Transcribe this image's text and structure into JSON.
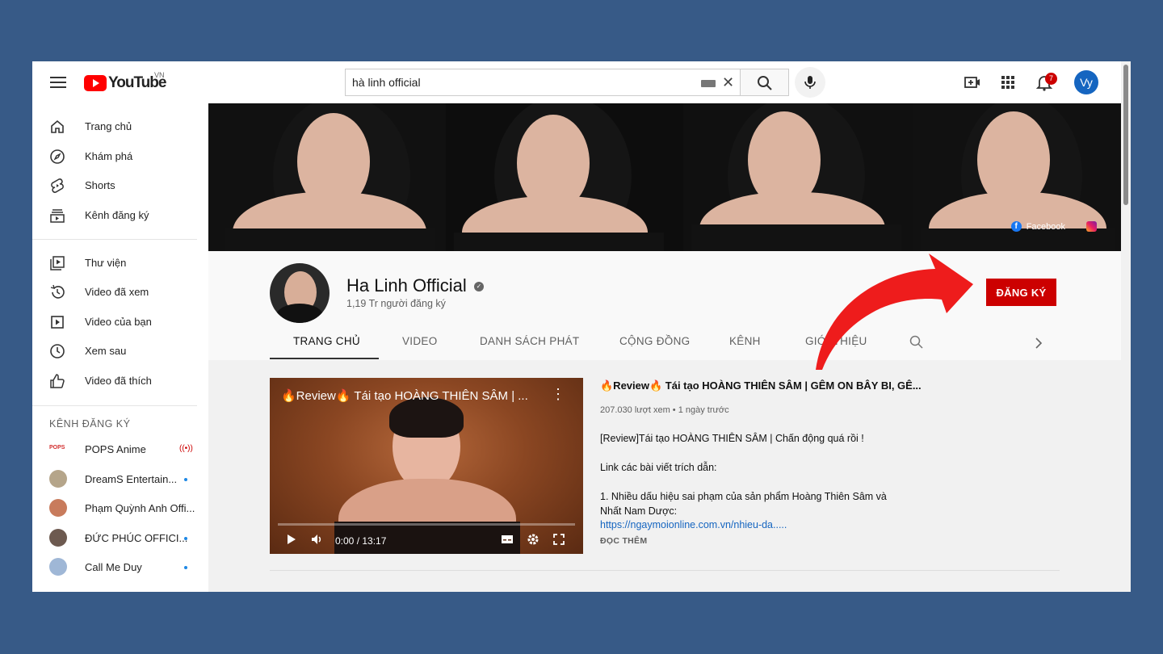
{
  "header": {
    "logo_text": "YouTube",
    "logo_region": "VN",
    "search_value": "hà linh official",
    "notification_count": "7",
    "avatar_initials": "Vy"
  },
  "sidebar": {
    "main": [
      {
        "label": "Trang chủ",
        "icon": "home-icon"
      },
      {
        "label": "Khám phá",
        "icon": "compass-icon"
      },
      {
        "label": "Shorts",
        "icon": "shorts-icon"
      },
      {
        "label": "Kênh đăng ký",
        "icon": "subscriptions-icon"
      }
    ],
    "library": [
      {
        "label": "Thư viện",
        "icon": "library-icon"
      },
      {
        "label": "Video đã xem",
        "icon": "history-icon"
      },
      {
        "label": "Video của bạn",
        "icon": "your-videos-icon"
      },
      {
        "label": "Xem sau",
        "icon": "clock-icon"
      },
      {
        "label": "Video đã thích",
        "icon": "thumbs-up-icon"
      }
    ],
    "subscriptions_heading": "KÊNH ĐĂNG KÝ",
    "subscriptions": [
      {
        "label": "POPS Anime",
        "status": "live"
      },
      {
        "label": "DreamS Entertain...",
        "status": "new"
      },
      {
        "label": "Phạm Quỳnh Anh Offi...",
        "status": ""
      },
      {
        "label": "ĐỨC PHÚC OFFICI...",
        "status": "new"
      },
      {
        "label": "Call Me Duy",
        "status": "new"
      }
    ]
  },
  "banner": {
    "facebook_label": "Facebook"
  },
  "channel": {
    "name": "Ha Linh Official",
    "subscribers": "1,19 Tr người đăng ký",
    "subscribe_label": "ĐĂNG KÝ",
    "tabs": [
      "TRANG CHỦ",
      "VIDEO",
      "DANH SÁCH PHÁT",
      "CỘNG ĐỒNG",
      "KÊNH",
      "GIỚI THIỆU"
    ]
  },
  "featured": {
    "player_title": "🔥Review🔥 Tái tạo HOÀNG THIÊN SÂM | ...",
    "time": "0:00 / 13:17",
    "title": "🔥Review🔥 Tái tạo HOÀNG THIÊN SÂM | GÊM ON BÂY BI, GÊ...",
    "meta": "207.030 lượt xem • 1 ngày trước",
    "desc_1": "[Review]Tái tạo HOÀNG THIÊN SÂM | Chấn động quá rồi !",
    "desc_2": "Link các bài viết trích dẫn:",
    "desc_3": "1. Nhiều dấu hiệu sai phạm của sản phẩm Hoàng Thiên Sâm và",
    "desc_4": "Nhất Nam Dược:",
    "link": "https://ngaymoionline.com.vn/nhieu-da.....",
    "read_more": "ĐỌC THÊM"
  },
  "colors": {
    "page_bg": "#375a87",
    "brand_red": "#ff0000",
    "subscribe_red": "#cc0000",
    "arrow_red": "#ee1c1c",
    "link_blue": "#1565c0"
  }
}
